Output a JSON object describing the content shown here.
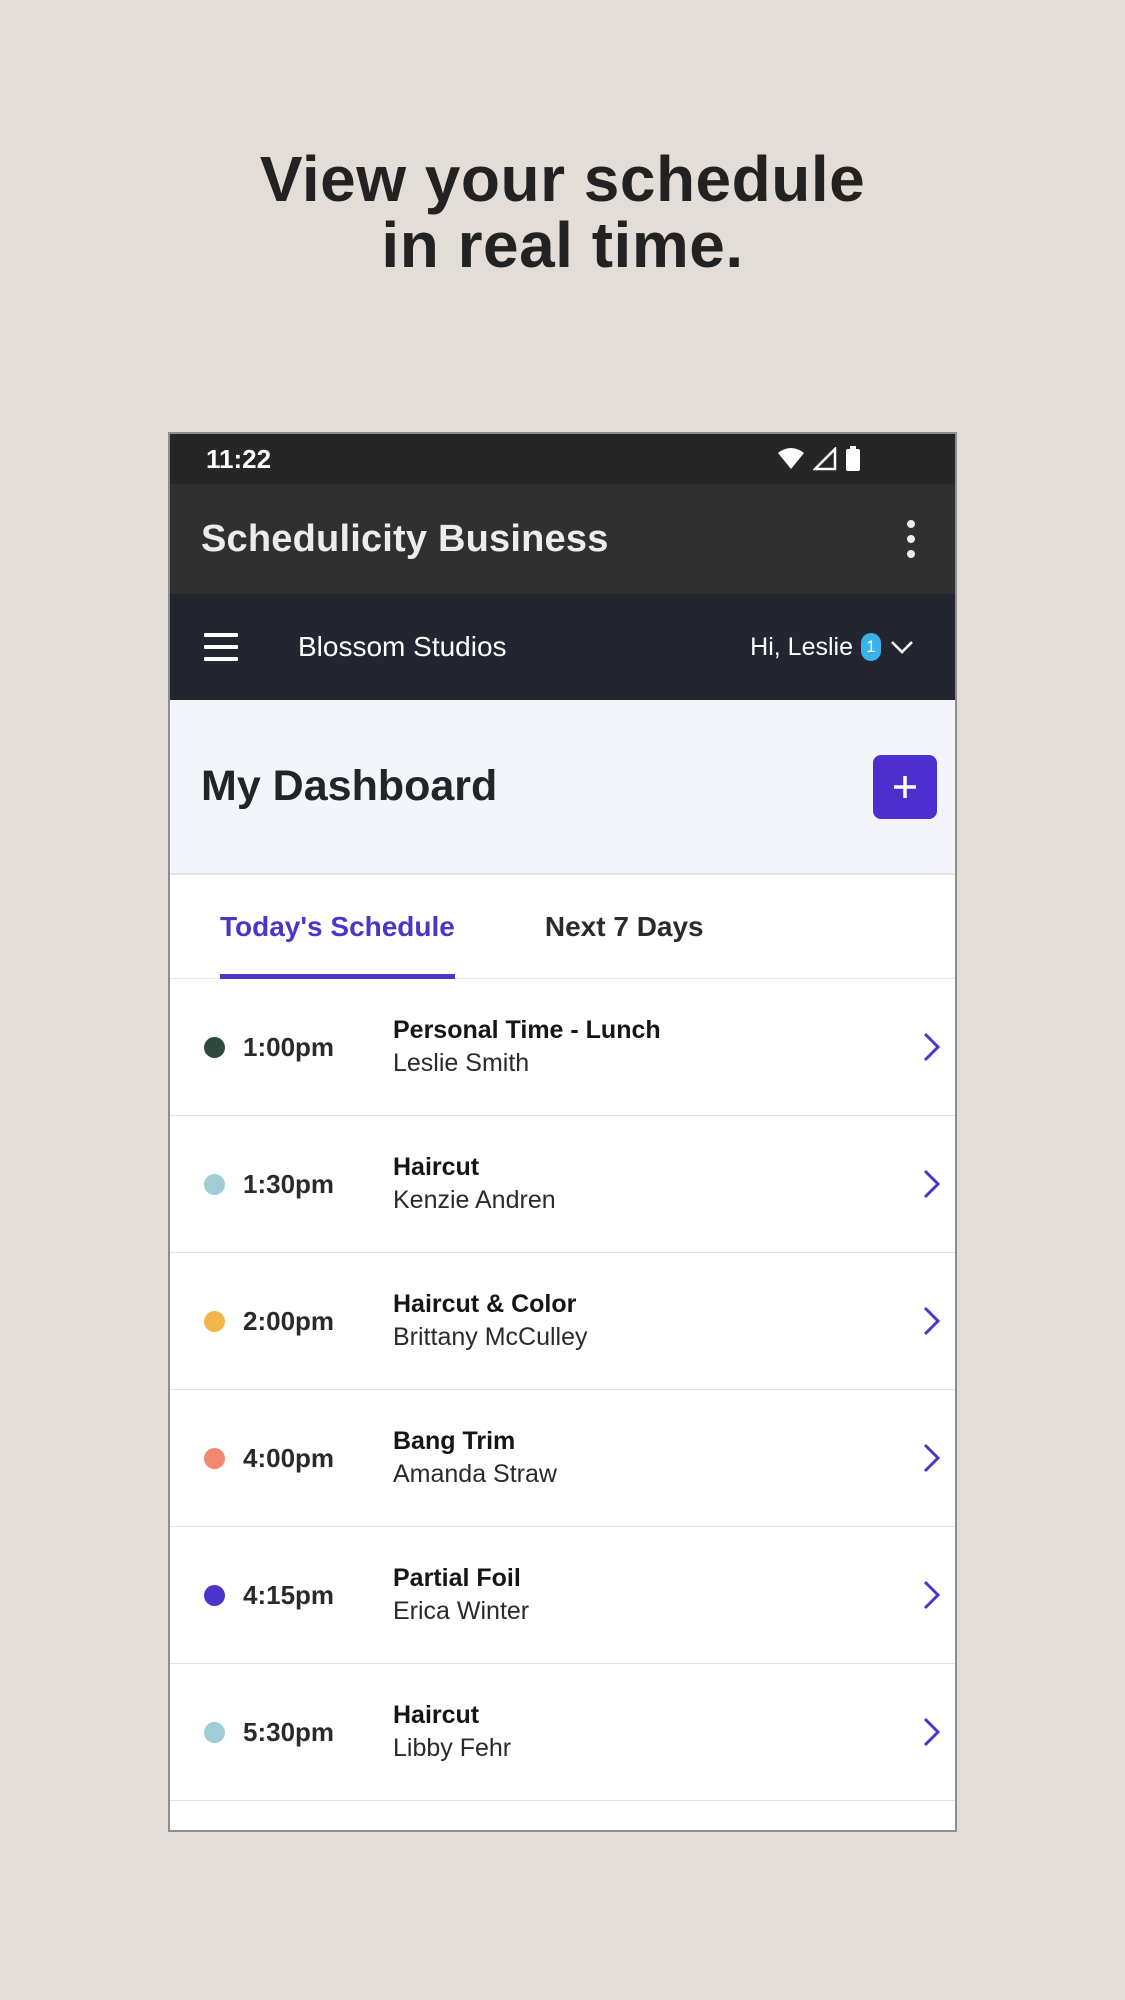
{
  "headline": {
    "line1": "View your schedule",
    "line2": "in real time."
  },
  "status_bar": {
    "time": "11:22",
    "icons": [
      "wifi-icon",
      "signal-icon",
      "battery-icon"
    ]
  },
  "app_bar": {
    "title": "Schedulicity Business",
    "menu_icon": "more-vert-icon"
  },
  "nav_bar": {
    "menu_icon": "hamburger-icon",
    "studio": "Blossom Studios",
    "greeting": "Hi, Leslie",
    "badge": "1",
    "dropdown_icon": "chevron-down-icon"
  },
  "dashboard": {
    "title": "My Dashboard",
    "add_label": "+"
  },
  "tabs": [
    {
      "label": "Today's Schedule",
      "active": true
    },
    {
      "label": "Next 7 Days",
      "active": false
    }
  ],
  "appointments": [
    {
      "time": "1:00pm",
      "service": "Personal Time - Lunch",
      "client": "Leslie Smith",
      "color": "#2c4b3c"
    },
    {
      "time": "1:30pm",
      "service": "Haircut",
      "client": "Kenzie Andren",
      "color": "#9ecdd6"
    },
    {
      "time": "2:00pm",
      "service": "Haircut & Color",
      "client": "Brittany McCulley",
      "color": "#f0b64b"
    },
    {
      "time": "4:00pm",
      "service": "Bang Trim",
      "client": "Amanda Straw",
      "color": "#f2886f"
    },
    {
      "time": "4:15pm",
      "service": "Partial Foil",
      "client": "Erica Winter",
      "color": "#4a34cc"
    },
    {
      "time": "5:30pm",
      "service": "Haircut",
      "client": "Libby Fehr",
      "color": "#9ecdd6"
    }
  ],
  "colors": {
    "background": "#e2ddd6",
    "accent": "#4d35c9",
    "appbar": "#303030",
    "navbar": "#232630",
    "statusbar": "#262626"
  }
}
